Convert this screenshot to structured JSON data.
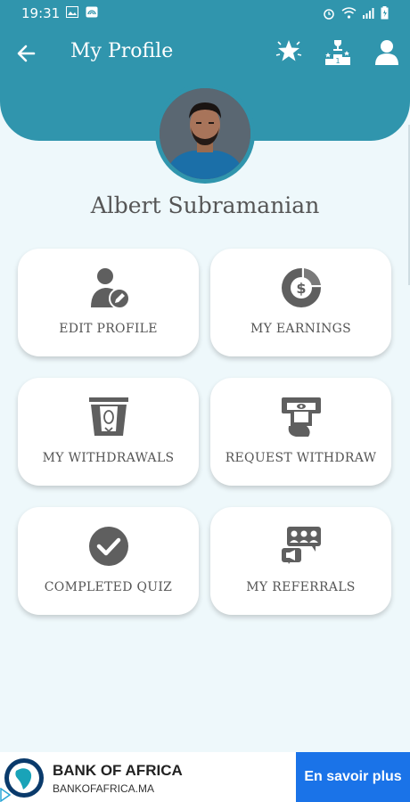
{
  "status_bar": {
    "time": "19:31"
  },
  "header": {
    "title": "My Profile",
    "back_icon": "arrow-left-icon",
    "actions": [
      "star-badge-icon",
      "leaderboard-icon",
      "user-icon"
    ]
  },
  "profile": {
    "name": "Albert Subramanian"
  },
  "menu": [
    {
      "label": "EDIT PROFILE",
      "icon": "edit-profile-icon"
    },
    {
      "label": "MY EARNINGS",
      "icon": "earnings-icon"
    },
    {
      "label": "MY WITHDRAWALS",
      "icon": "withdrawals-icon"
    },
    {
      "label": "REQUEST WITHDRAW",
      "icon": "request-withdraw-icon"
    },
    {
      "label": "COMPLETED QUIZ",
      "icon": "check-circle-icon"
    },
    {
      "label": "MY REFERRALS",
      "icon": "referrals-icon"
    }
  ],
  "ad": {
    "title": "BANK OF AFRICA",
    "url": "BANKOFAFRICA.MA",
    "cta": "En savoir plus"
  },
  "colors": {
    "primary": "#3095ad",
    "background": "#eef8fb",
    "icon": "#5f5f5f",
    "ad_cta": "#1a73e8"
  }
}
